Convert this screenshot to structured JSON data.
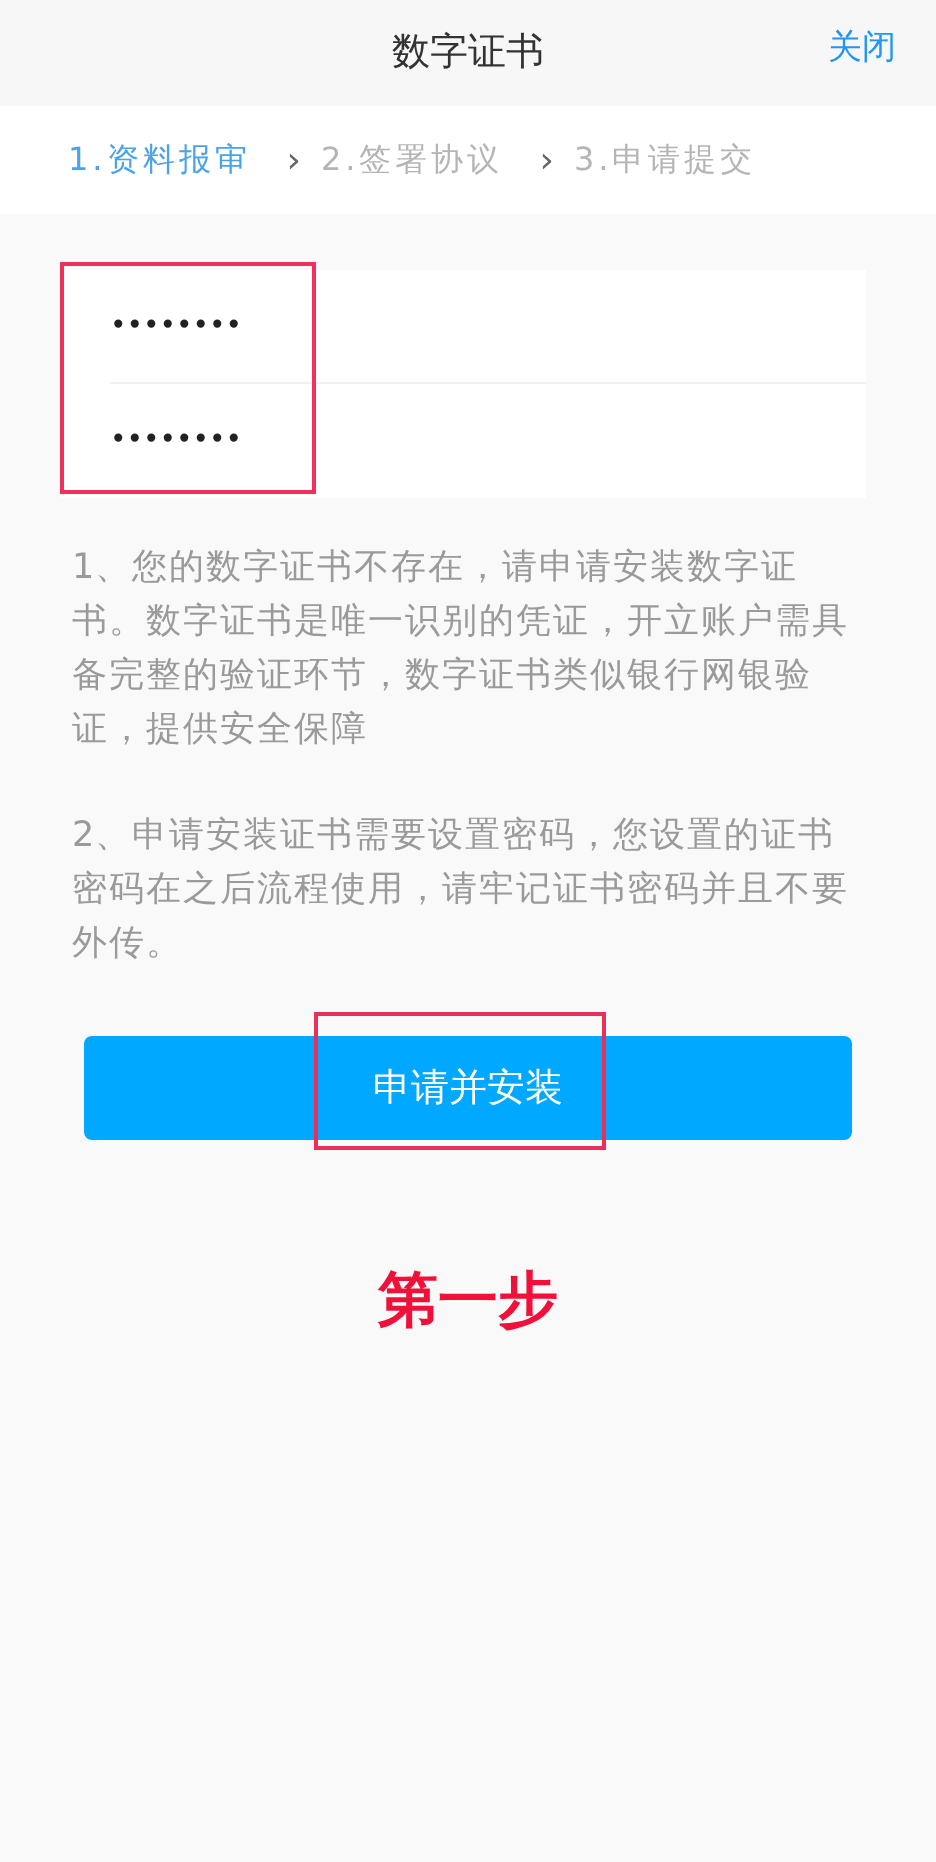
{
  "header": {
    "title": "数字证书",
    "close": "关闭"
  },
  "steps": [
    {
      "label": "1.资料报审",
      "selected": true,
      "separator": "›"
    },
    {
      "label": "2.签署协议",
      "selected": false,
      "separator": "›"
    },
    {
      "label": "3.申请提交",
      "selected": false
    }
  ],
  "password_fields": {
    "highlighted": true,
    "items": [
      {
        "value": "••••••••"
      },
      {
        "value": "••••••••"
      }
    ]
  },
  "notes": [
    "1、您的数字证书不存在，请申请安装数字证书。数字证书是唯一识别的凭证，开立账户需具备完整的验证环节，数字证书类似银行网银验证，提供安全保障",
    "2、申请安装证书需要设置密码，您设置的证书密码在之后流程使用，请牢记证书密码并且不要外传。"
  ],
  "install_button": {
    "label": "申请并安装",
    "highlighted": true
  },
  "step_caption": "第一步"
}
